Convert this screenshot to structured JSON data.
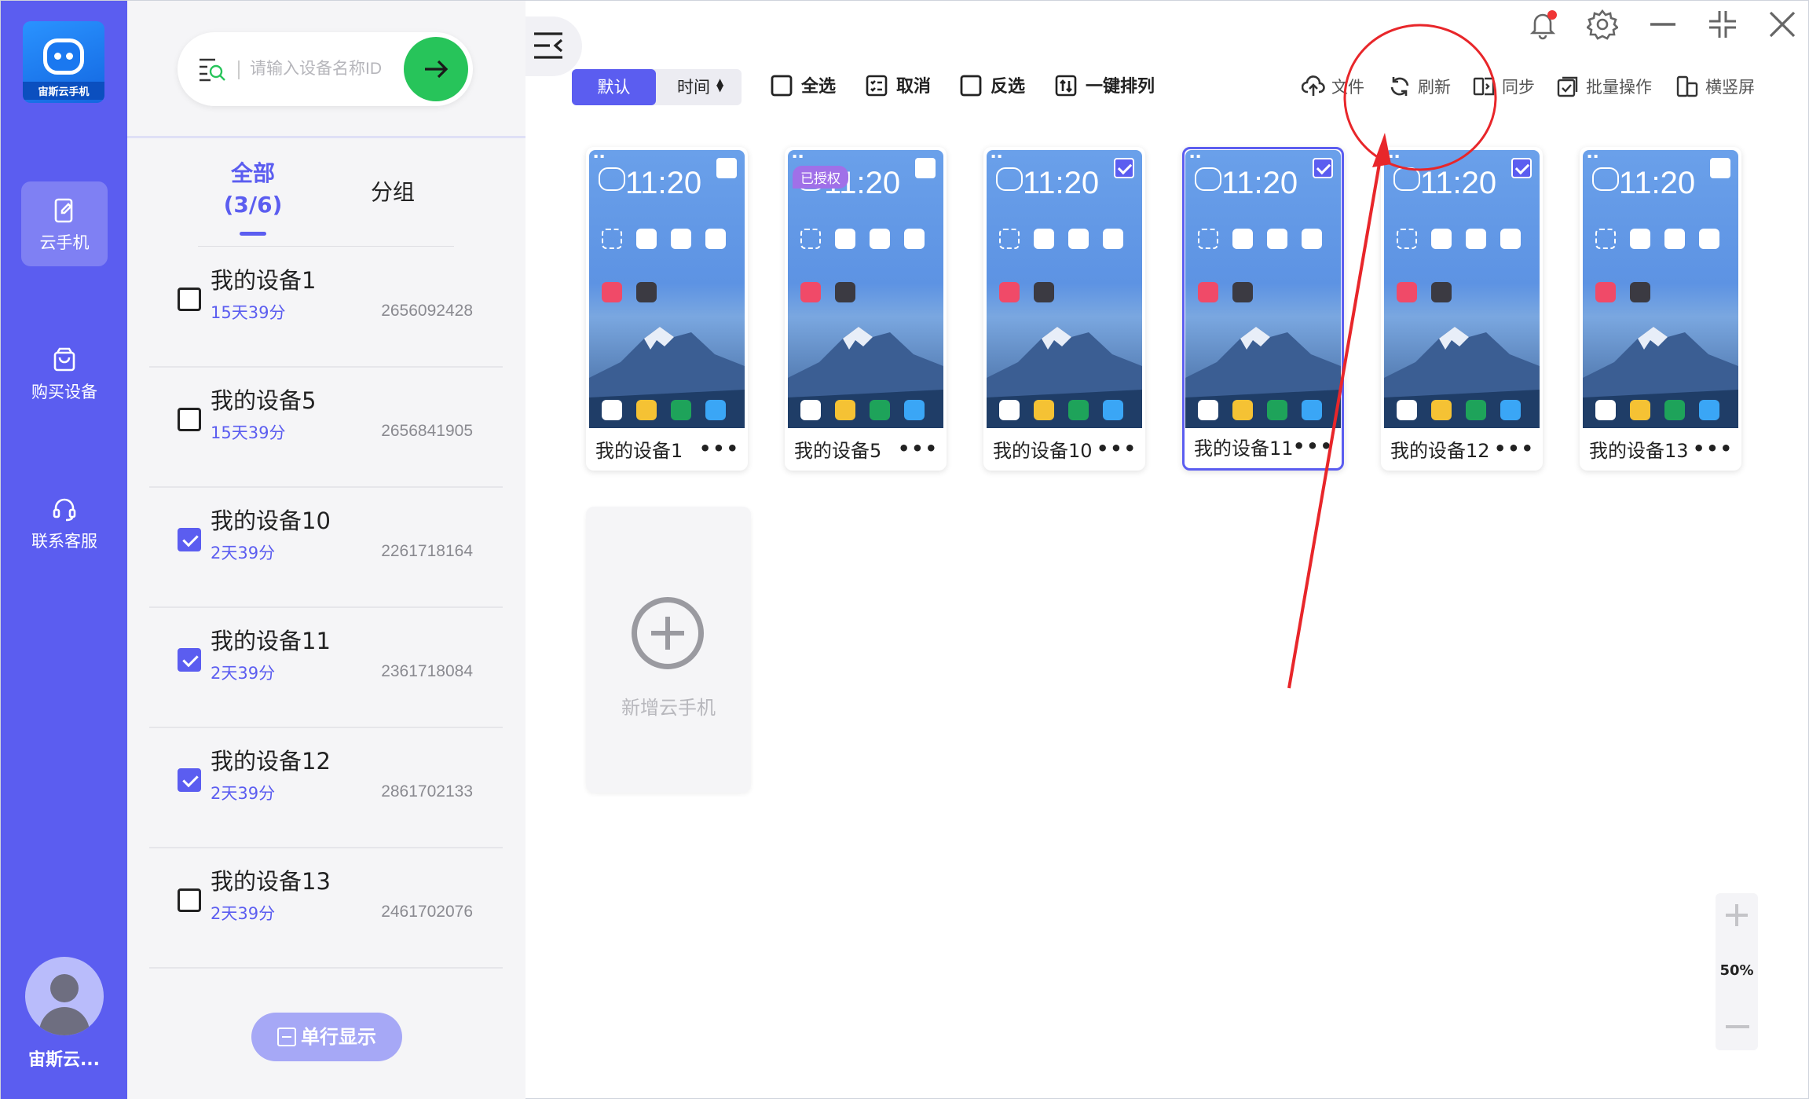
{
  "app": {
    "logo_text": "宙斯云手机",
    "user_name": "宙斯云..."
  },
  "rail": {
    "items": [
      {
        "label": "云手机",
        "icon": "phone-edit-icon",
        "active": true
      },
      {
        "label": "购买设备",
        "icon": "shopping-bag-icon",
        "active": false
      },
      {
        "label": "联系客服",
        "icon": "headset-icon",
        "active": false
      }
    ]
  },
  "search": {
    "placeholder": "请输入设备名称ID"
  },
  "list_tabs": {
    "all_label": "全部",
    "all_count": "(3/6)",
    "group_label": "分组"
  },
  "devices": [
    {
      "name": "我的设备1",
      "time": "15天39分",
      "id": "2656092428",
      "checked": false
    },
    {
      "name": "我的设备5",
      "time": "15天39分",
      "id": "2656841905",
      "checked": false
    },
    {
      "name": "我的设备10",
      "time": "2天39分",
      "id": "2261718164",
      "checked": true
    },
    {
      "name": "我的设备11",
      "time": "2天39分",
      "id": "2361718084",
      "checked": true
    },
    {
      "name": "我的设备12",
      "time": "2天39分",
      "id": "2861702133",
      "checked": true
    },
    {
      "name": "我的设备13",
      "time": "2天39分",
      "id": "2461702076",
      "checked": false
    }
  ],
  "single_row_label": "单行显示",
  "toolbar": {
    "sort_default": "默认",
    "sort_time": "时间",
    "select_all": "全选",
    "cancel": "取消",
    "invert": "反选",
    "arrange": "一键排列",
    "file": "文件",
    "refresh": "刷新",
    "sync": "同步",
    "batch": "批量操作",
    "orientation": "横竖屏"
  },
  "cards": [
    {
      "name": "我的设备1",
      "time": "11:20",
      "checked": false,
      "selected": false,
      "tag": ""
    },
    {
      "name": "我的设备5",
      "time": "11:20",
      "checked": false,
      "selected": false,
      "tag": "已授权"
    },
    {
      "name": "我的设备10",
      "time": "11:20",
      "checked": true,
      "selected": false,
      "tag": ""
    },
    {
      "name": "我的设备11",
      "time": "11:20",
      "checked": true,
      "selected": true,
      "tag": ""
    },
    {
      "name": "我的设备12",
      "time": "11:20",
      "checked": true,
      "selected": false,
      "tag": ""
    },
    {
      "name": "我的设备13",
      "time": "11:20",
      "checked": false,
      "selected": false,
      "tag": ""
    }
  ],
  "add_card_label": "新增云手机",
  "zoom": {
    "value": "50%"
  },
  "colors": {
    "accent": "#5b5df0",
    "go_button": "#27c45a",
    "annotation": "#e8262a"
  }
}
